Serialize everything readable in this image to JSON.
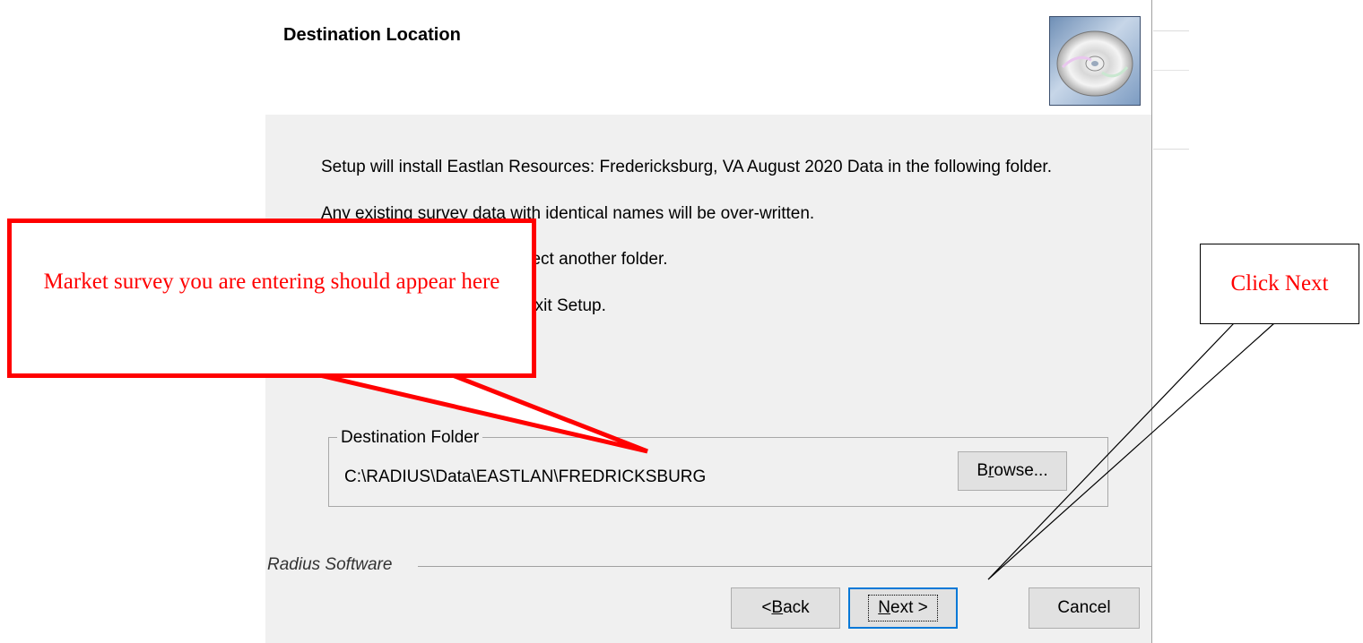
{
  "dialog": {
    "title": "Destination Location",
    "intro_line1": "Setup will install Eastlan Resources: Fredericksburg, VA August 2020 Data in the following folder.",
    "intro_line2": "Any existing survey data with identical names will be over-written.",
    "intro_line3": "folder, click Browse, and select another folder.",
    "intro_line4": "nstall  by clicking Cancel to exit Setup.",
    "group_label": "Destination Folder",
    "folder_path": "C:\\RADIUS\\Data\\EASTLAN\\FREDRICKSBURG",
    "brand": "Radius Software",
    "icon": "cd-disc-icon"
  },
  "buttons": {
    "browse_pre": "B",
    "browse_ul": "r",
    "browse_post": "owse...",
    "back_pre": "< ",
    "back_ul": "B",
    "back_post": "ack",
    "next_ul": "N",
    "next_post": "ext >",
    "cancel": "Cancel"
  },
  "annotations": {
    "red_callout": "Market survey you are entering should appear here",
    "black_callout": "Click Next",
    "red_color": "#ff0000"
  }
}
